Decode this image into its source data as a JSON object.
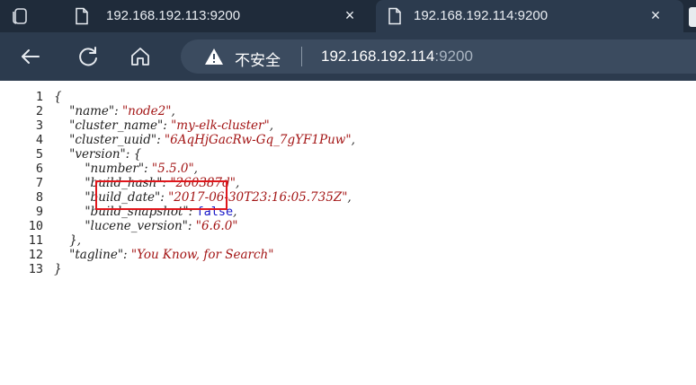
{
  "tabs": [
    {
      "title": "192.168.192.113:9200",
      "close": "×",
      "active": false
    },
    {
      "title": "192.168.192.114:9200",
      "close": "×",
      "active": true
    }
  ],
  "toolbar": {
    "security_label": "不安全",
    "url_host": "192.168.192.114",
    "url_port": ":9200"
  },
  "json_lines": [
    {
      "num": "1",
      "indent": "",
      "parts": [
        {
          "t": "p",
          "v": "{"
        }
      ]
    },
    {
      "num": "2",
      "indent": "    ",
      "parts": [
        {
          "t": "k",
          "v": "\"name\""
        },
        {
          "t": "p",
          "v": ": "
        },
        {
          "t": "s",
          "v": "\"node2\""
        },
        {
          "t": "p",
          "v": ","
        }
      ]
    },
    {
      "num": "3",
      "indent": "    ",
      "parts": [
        {
          "t": "k",
          "v": "\"cluster_name\""
        },
        {
          "t": "p",
          "v": ": "
        },
        {
          "t": "s",
          "v": "\"my-elk-cluster\""
        },
        {
          "t": "p",
          "v": ","
        }
      ]
    },
    {
      "num": "4",
      "indent": "    ",
      "parts": [
        {
          "t": "k",
          "v": "\"cluster_uuid\""
        },
        {
          "t": "p",
          "v": ": "
        },
        {
          "t": "s",
          "v": "\"6AqHjGacRw-Gq_7gYF1Puw\""
        },
        {
          "t": "p",
          "v": ","
        }
      ]
    },
    {
      "num": "5",
      "indent": "    ",
      "parts": [
        {
          "t": "k",
          "v": "\"version\""
        },
        {
          "t": "p",
          "v": ": {"
        }
      ]
    },
    {
      "num": "6",
      "indent": "        ",
      "parts": [
        {
          "t": "k",
          "v": "\"number\""
        },
        {
          "t": "p",
          "v": ": "
        },
        {
          "t": "s",
          "v": "\"5.5.0\""
        },
        {
          "t": "p",
          "v": ","
        }
      ]
    },
    {
      "num": "7",
      "indent": "        ",
      "parts": [
        {
          "t": "k",
          "v": "\"build_hash\""
        },
        {
          "t": "p",
          "v": ": "
        },
        {
          "t": "s",
          "v": "\"260387d\""
        },
        {
          "t": "p",
          "v": ","
        }
      ]
    },
    {
      "num": "8",
      "indent": "        ",
      "parts": [
        {
          "t": "k",
          "v": "\"build_date\""
        },
        {
          "t": "p",
          "v": ": "
        },
        {
          "t": "s",
          "v": "\"2017-06-30T23:16:05.735Z\""
        },
        {
          "t": "p",
          "v": ","
        }
      ]
    },
    {
      "num": "9",
      "indent": "        ",
      "parts": [
        {
          "t": "k",
          "v": "\"build_snapshot\""
        },
        {
          "t": "p",
          "v": ": "
        },
        {
          "t": "b",
          "v": "false"
        },
        {
          "t": "p",
          "v": ","
        }
      ]
    },
    {
      "num": "10",
      "indent": "        ",
      "parts": [
        {
          "t": "k",
          "v": "\"lucene_version\""
        },
        {
          "t": "p",
          "v": ": "
        },
        {
          "t": "s",
          "v": "\"6.6.0\""
        }
      ]
    },
    {
      "num": "11",
      "indent": "    ",
      "parts": [
        {
          "t": "p",
          "v": "},"
        }
      ]
    },
    {
      "num": "12",
      "indent": "    ",
      "parts": [
        {
          "t": "k",
          "v": "\"tagline\""
        },
        {
          "t": "p",
          "v": ": "
        },
        {
          "t": "s",
          "v": "\"You Know, for Search\""
        }
      ]
    },
    {
      "num": "13",
      "indent": "",
      "parts": [
        {
          "t": "p",
          "v": "}"
        }
      ]
    }
  ]
}
